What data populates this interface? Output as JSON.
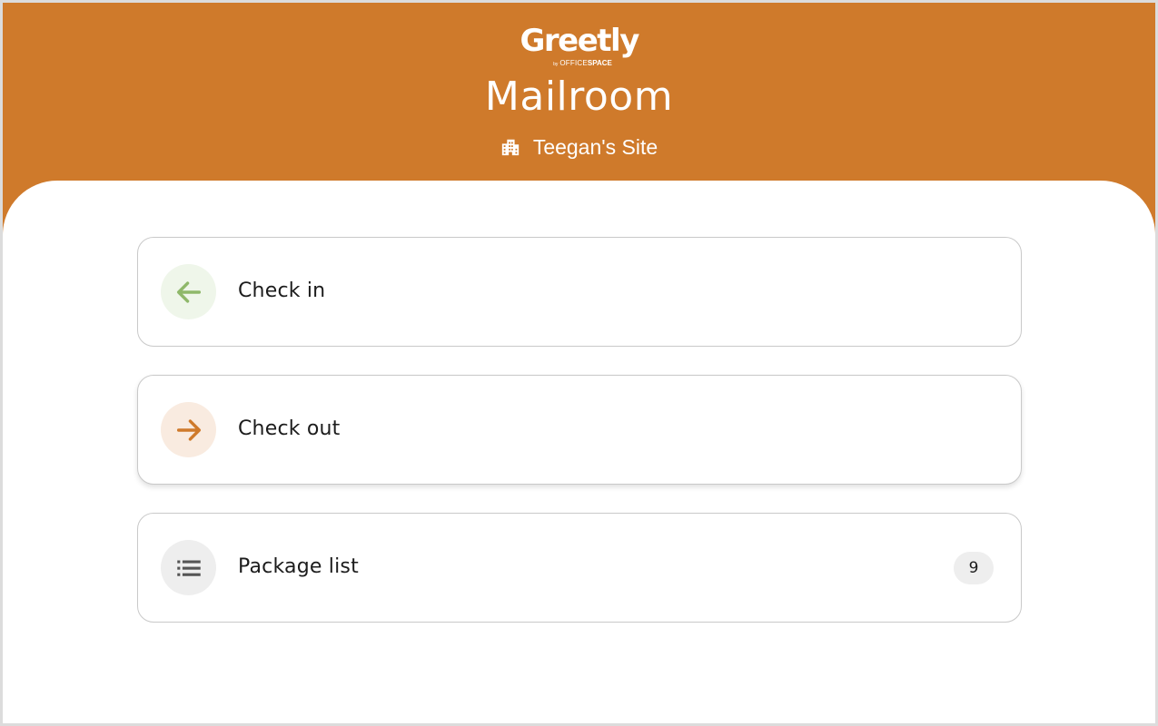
{
  "brand": {
    "logo_text": "Greetly",
    "logo_by": "by",
    "logo_office": "OFFICE",
    "logo_space": "SPACE"
  },
  "header": {
    "title": "Mailroom",
    "site_name": "Teegan's Site",
    "site_icon": "building-icon",
    "background_color": "#cf7a2b"
  },
  "menu": {
    "items": [
      {
        "label": "Check in",
        "icon": "arrow-left-icon",
        "icon_color": "#8fb86a",
        "icon_bg": "#eff6ea"
      },
      {
        "label": "Check out",
        "icon": "arrow-right-icon",
        "icon_color": "#cf7a2b",
        "icon_bg": "#f9ebe0"
      },
      {
        "label": "Package list",
        "icon": "list-icon",
        "icon_color": "#555555",
        "icon_bg": "#eeeeee",
        "count": "9"
      }
    ]
  }
}
